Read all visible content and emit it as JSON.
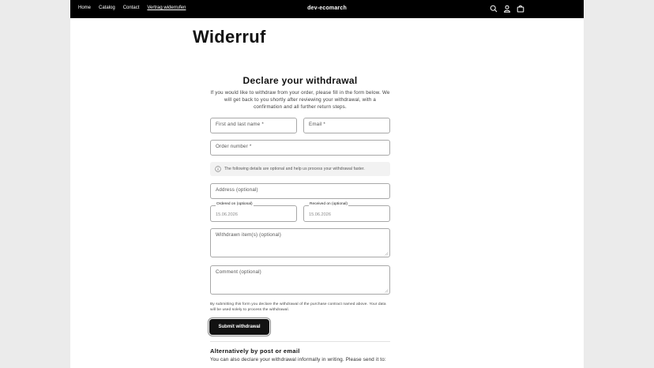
{
  "header": {
    "nav": [
      "Home",
      "Catalog",
      "Contact",
      "Vertrag widerrufen"
    ],
    "brand": "dev-ecomarch",
    "icons": [
      "search-icon",
      "account-icon",
      "cart-icon"
    ]
  },
  "page": {
    "title": "Widerruf"
  },
  "form": {
    "heading": "Declare your withdrawal",
    "intro": "If you would like to withdraw from your order, please fill in the form below. We will get back to you shortly after reviewing your withdrawal, with a confirmation and all further return steps.",
    "name_label": "First and last name *",
    "email_label": "Email *",
    "order_label": "Order number *",
    "notice": "The following details are optional and help us process your withdrawal faster.",
    "address_label": "Address (optional)",
    "ordered_label": "Ordered on (optional)",
    "ordered_value": "15.06.2026",
    "received_label": "Received on (optional)",
    "received_value": "15.06.2026",
    "items_label": "Withdrawn item(s) (optional)",
    "comment_label": "Comment (optional)",
    "consent": "By submitting this form you declare the withdrawal of the purchase contract named above. Your data will be used solely to process the withdrawal.",
    "submit_label": "Submit withdrawal"
  },
  "alternative": {
    "heading": "Alternatively by post or email",
    "text": "You can also declare your withdrawal informally in writing. Please send it to:"
  },
  "colors": {
    "header_bg": "#000000",
    "button_bg": "#121212",
    "page_bg": "#ffffff",
    "outer_bg": "#ebebeb"
  }
}
